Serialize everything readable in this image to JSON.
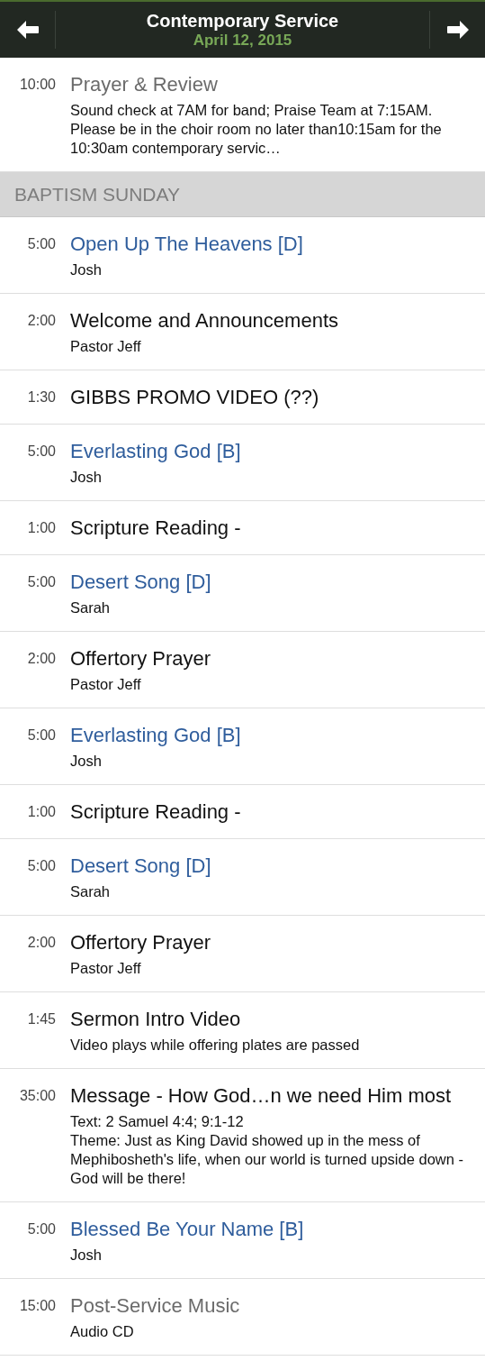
{
  "header": {
    "title": "Contemporary Service",
    "date": "April 12, 2015"
  },
  "items": [
    {
      "kind": "other",
      "time": "10:00",
      "title": "Prayer & Review",
      "details": [
        "Sound check at 7AM for band; Praise Team at 7:15AM. Please be in the choir room no later than10:15am for the 10:30am contemporary servic…"
      ]
    },
    {
      "kind": "section",
      "title": "BAPTISM SUNDAY"
    },
    {
      "kind": "song",
      "time": "5:00",
      "title": "Open Up The Heavens [D]",
      "details": [
        "Josh"
      ]
    },
    {
      "kind": "item",
      "time": "2:00",
      "title": "Welcome and Announcements",
      "details": [
        "Pastor Jeff"
      ]
    },
    {
      "kind": "item",
      "time": "1:30",
      "title": "GIBBS PROMO VIDEO (??)"
    },
    {
      "kind": "song",
      "time": "5:00",
      "title": "Everlasting God [B]",
      "details": [
        "Josh"
      ]
    },
    {
      "kind": "item",
      "time": "1:00",
      "title": "Scripture Reading -"
    },
    {
      "kind": "song",
      "time": "5:00",
      "title": "Desert Song [D]",
      "details": [
        "Sarah"
      ]
    },
    {
      "kind": "item",
      "time": "2:00",
      "title": "Offertory Prayer",
      "details": [
        "Pastor Jeff"
      ]
    },
    {
      "kind": "song",
      "time": "5:00",
      "title": "Everlasting God [B]",
      "details": [
        "Josh"
      ]
    },
    {
      "kind": "item",
      "time": "1:00",
      "title": "Scripture Reading -"
    },
    {
      "kind": "song",
      "time": "5:00",
      "title": "Desert Song [D]",
      "details": [
        "Sarah"
      ]
    },
    {
      "kind": "item",
      "time": "2:00",
      "title": "Offertory Prayer",
      "details": [
        "Pastor Jeff"
      ]
    },
    {
      "kind": "item",
      "time": "1:45",
      "title": "Sermon Intro Video",
      "details": [
        "Video plays while offering plates are passed"
      ]
    },
    {
      "kind": "item",
      "time": "35:00",
      "title": "Message - How God…n we need Him most",
      "details": [
        "Text: 2 Samuel 4:4; 9:1-12",
        "Theme: Just as King David showed up in the mess of Mephibosheth's life, when our world is turned upside down - God will be there!"
      ]
    },
    {
      "kind": "song",
      "time": "5:00",
      "title": "Blessed Be Your Name [B]",
      "details": [
        "Josh"
      ]
    },
    {
      "kind": "other",
      "time": "15:00",
      "title": "Post-Service Music",
      "details": [
        "Audio CD"
      ]
    }
  ]
}
